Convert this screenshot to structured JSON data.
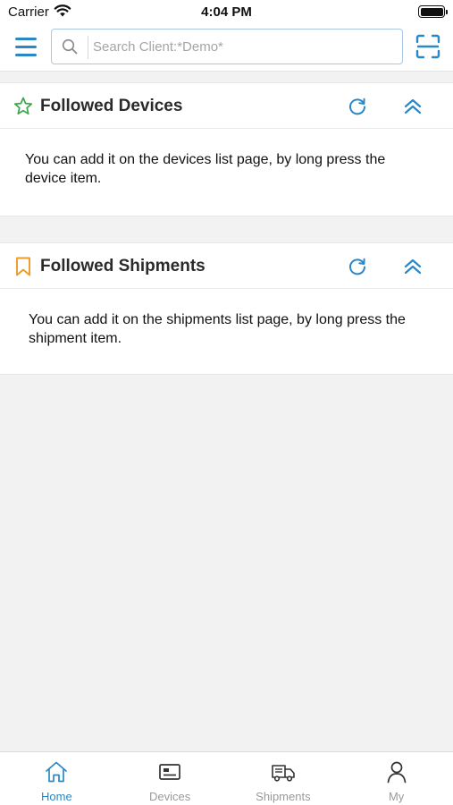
{
  "status_bar": {
    "carrier": "Carrier",
    "time": "4:04 PM"
  },
  "header": {
    "menu_icon": "hamburger-icon",
    "search_placeholder": "Search Client:*Demo*",
    "scan_icon": "scan-icon"
  },
  "cards": [
    {
      "icon": "star-outline-icon",
      "icon_color": "#3aa64a",
      "title": "Followed Devices",
      "message": "You can add it on the devices list page, by long press the device item."
    },
    {
      "icon": "bookmark-icon",
      "icon_color": "#f09a2a",
      "title": "Followed Shipments",
      "message": "You can add it on the shipments list page, by long press the shipment item."
    }
  ],
  "tabs": [
    {
      "label": "Home",
      "icon": "home-icon",
      "active": true
    },
    {
      "label": "Devices",
      "icon": "device-card-icon",
      "active": false
    },
    {
      "label": "Shipments",
      "icon": "truck-icon",
      "active": false
    },
    {
      "label": "My",
      "icon": "person-icon",
      "active": false
    }
  ],
  "colors": {
    "accent": "#2a88c8",
    "background": "#f2f2f2",
    "inactive_tab": "#9a9a9a"
  }
}
